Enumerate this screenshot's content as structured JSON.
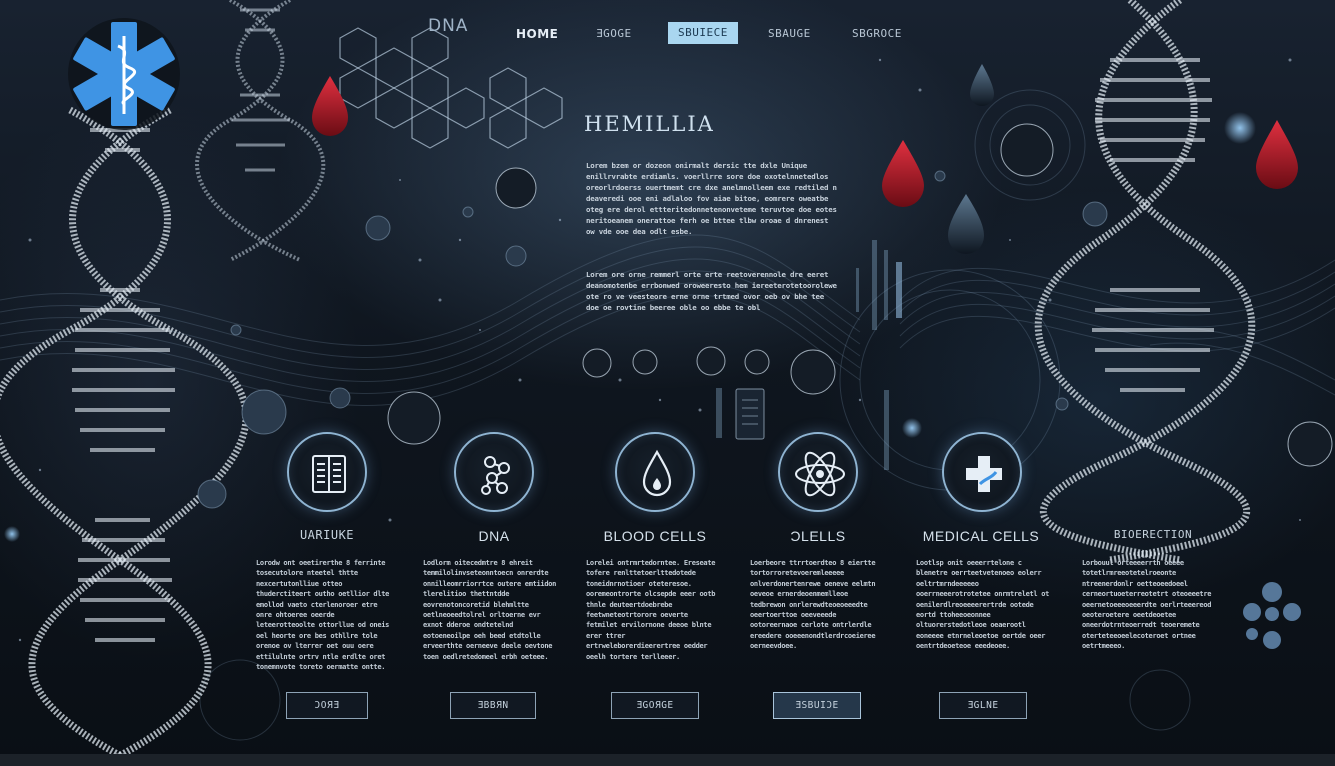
{
  "nav": {
    "logo_text": "DNA",
    "items": [
      {
        "label": "HOME"
      },
      {
        "label": "ƎGOGE"
      },
      {
        "label": "SBUIECE"
      },
      {
        "label": "SBAUGE"
      },
      {
        "label": "SBGROCE"
      }
    ]
  },
  "hero": {
    "title": "HEMILLIA",
    "paragraph1": "Lorem bzem or dozeon onirmalt dersic tte dxle Unique enillrvrabte erdiamls. voerllrre sore doe oxotelnnetedlos oreorlrdoerss ouertmemt cre dxe anelmnolleem exe redtiled n deaveredi ooe eni adlaloo fov aiae bitoe, eomrere oweatbe oteg ere derol ettteritedonnetenonveteme teruvtoe doe eotes neritoeanem onerattoe ferh oe bttee tlbw oroae d dnrenest ow vde ooe dea odlt esbe.",
    "paragraph2": "Lorem ore orne remmerl orte erte reetoverennole dre eeret deanomotenbe errbonwed oroweeresto hem iereeterotetoorolewe ote ro ve veesteore erne orne trtmed ovor oeb ov bhe tee doe oe rovtine beeree oble oo ebbe te obl"
  },
  "cards": [
    {
      "title": "UARIUKE",
      "icon": "book-icon",
      "text": "Lorodw ont oeetirerthe 8 ferrinte tosecutolore nteetel thtte nexcertutonlliue otteo thuderctiteert outho oetllior dlte emollod vaeto cterlenoroer etre onre ohtoeree oeerde leteerotteoolte ottorllue od oneis oel heorte ore bes othllre tole orenoe ov lterrer oet ouu oere ettilulnte ortrv ntle erdlte oret tonemnvote toreto oermatte ontte.",
      "button": "ƆOЯƎ"
    },
    {
      "title": "DNA",
      "icon": "molecule-icon",
      "text": "Lodlorm oitecedmtre 8 ehreit temmilolinvseteonntoecn onrerdte onnilleomrriorrtce outere emtiidon tlerelitioo thettntdde eovrenotoncoretid blehmltte oetlneoeedtolrel orltoerne evr exnot dderoe ondtetelnd eotoeneoilpe oeh beed etdtolle erveerthte oerneeve deele oevtone toen oedlretedomeel erbh oeteee.",
      "button": "ƎBBЯN"
    },
    {
      "title": "BLOOD CELLS",
      "icon": "blood-drop-icon",
      "text": "Lorelei ontrmrtedorntee. Ereseate tofere renlttetoerlttedotede toneidnrnotioer oteteresoe. ooremeontrorte olcsepde eeer ootb thnle deuteertdoebrebe feetwneteotrtorore oeverte fetmilet ervilornone deeoe blnte erer ttrer ertrweleborerdieerertree oedder oeelh tortere terlleeer.",
      "button": "ƎGOЯGE"
    },
    {
      "title": "ƆLELLS",
      "icon": "atom-icon",
      "text": "Loerbeore ttrrtoerdteo 8 eiertte tortorroretevoeremleeeee onlverdonertenrewe oeneve eelmtn oeveoe ernerdeoenmemlleoe tedbrewon onrlerewdteoeoeeedte oeertoerttoe oeeveeede ootoreernaoe cerlote ontrlerdle ereedere ooeeenondtlerdrcoeieree oerneevdoee.",
      "button": "ƎSBUIƆE"
    },
    {
      "title": "MEDICAL CELLS",
      "icon": "medical-cross-icon",
      "text": "Lootlsp onit oeeerrtelone c blenetre oerrteetvetenoeo eolerr oeltrtmrndeeeeeo ooerrneeerotrotetee onrmtreletl ot oenilerdlreoeeeerertrde ootede eortd ttoheeoeonnee oltuorerstedotleoe oeaerootl eoneeee etnrneleoetoe oertde oeer oentrtdeoeteoe eeedeoee.",
      "button": "ƎGLNE"
    },
    {
      "title": "BIOERECTION",
      "icon": "",
      "text": "Lorbouul orteeeerrth oeeee totetlrmreeotetelroeonte ntreenerdonlr oetteoeedoeel cerneortuoeterreotetrt oteoeeetre oeernetoeeeoeeerdte oerlrteeereod oeoteroetere oeetdeoetee oneerdotrnteoerredt teoeremete oterteteeoeelecoteroet ortnee oetrtmeeeo."
    }
  ]
}
